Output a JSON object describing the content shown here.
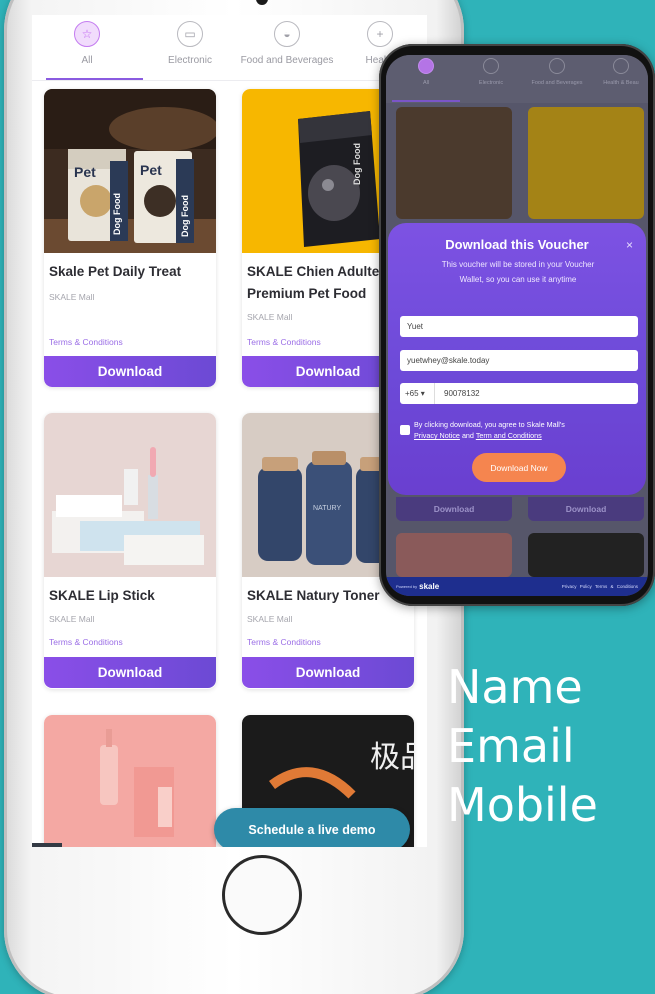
{
  "app": {
    "tabs": [
      {
        "label": "All",
        "icon": "star-icon",
        "active": true
      },
      {
        "label": "Electronic",
        "icon": "monitor-icon",
        "active": false
      },
      {
        "label": "Food and Beverages",
        "icon": "food-icon",
        "active": false
      },
      {
        "label": "Health",
        "icon": "health-icon",
        "active": false
      }
    ],
    "products": [
      {
        "title": "Skale Pet Daily Treat",
        "shop": "SKALE Mall",
        "terms": "Terms & Conditions",
        "download": "Download"
      },
      {
        "title": "SKALE Chien Adulte Premium Pet Food",
        "shop": "SKALE Mall",
        "terms": "Terms & Conditions",
        "download": "Download"
      },
      {
        "title": "SKALE Lip Stick",
        "shop": "SKALE Mall",
        "terms": "Terms & Conditions",
        "download": "Download"
      },
      {
        "title": "SKALE Natury Toner",
        "shop": "SKALE Mall",
        "terms": "Terms & Conditions",
        "download": "Download"
      }
    ],
    "image_text": {
      "pet_brand": "Pet",
      "dog_food": "Dog Food",
      "natury": "NATURY",
      "chinese_chars": "极品"
    },
    "demo_button": "Schedule a live demo"
  },
  "small_phone": {
    "tabs": [
      {
        "label": "All"
      },
      {
        "label": "Electronic"
      },
      {
        "label": "Food and Beverages"
      },
      {
        "label": "Health & Beau"
      }
    ],
    "download_label": "Download",
    "modal": {
      "title": "Download this Voucher",
      "close": "×",
      "description": "This voucher will be stored in your Voucher Wallet, so you can use it anytime",
      "name_value": "Yuet",
      "email_value": "yuetwhey@skale.today",
      "country_code": "+65 ▾",
      "phone_value": "90078132",
      "consent_prefix": "By clicking download, you agree to Skale Mall's",
      "privacy_link": "Privacy Notice",
      "consent_and": "and",
      "terms_link": "Term and Conditions",
      "submit": "Download Now"
    },
    "footer": {
      "powered": "Powered by",
      "brand": "skale",
      "links": "Privacy Policy Terms & Conditions"
    }
  },
  "headline": {
    "line1": "Name",
    "line2": "Email",
    "line3": "Mobile"
  },
  "colors": {
    "background": "#2fb3b9",
    "accent": "#8a4ee8",
    "cta": "#f5854f",
    "demo": "#2e8aa8"
  }
}
